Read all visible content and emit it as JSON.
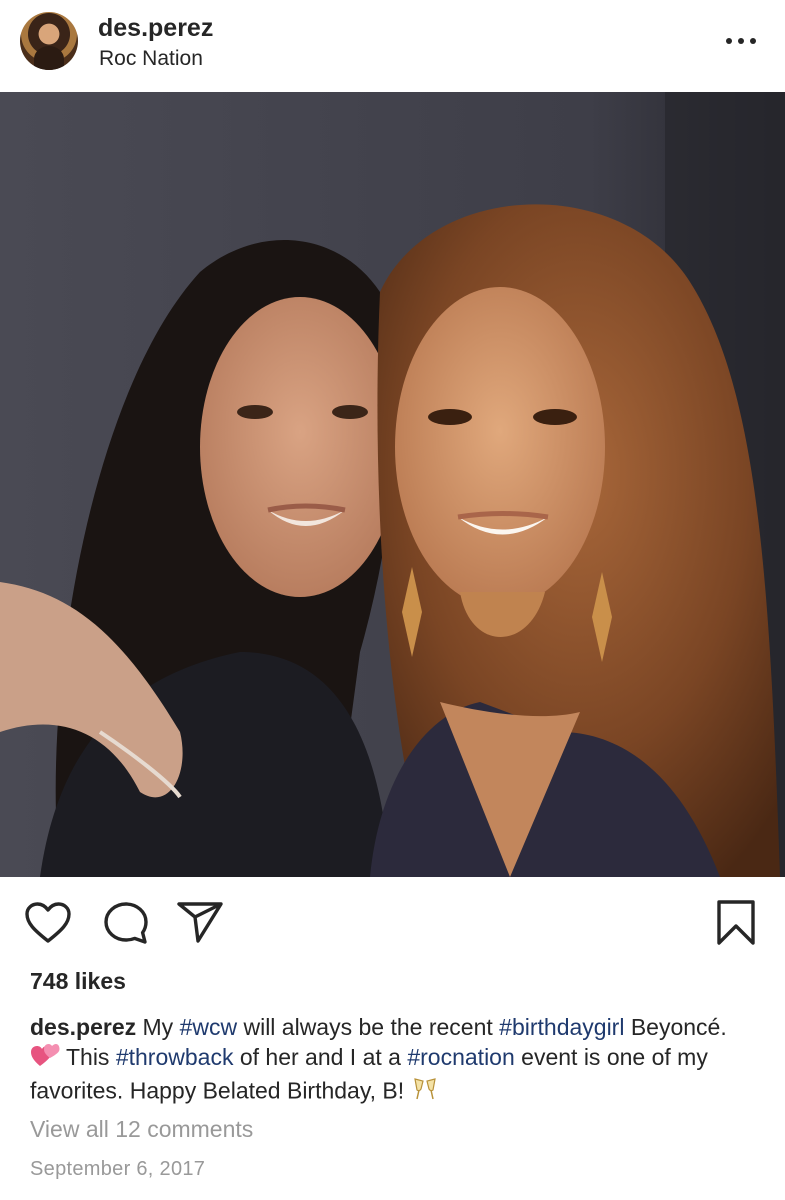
{
  "header": {
    "username": "des.perez",
    "location": "Roc Nation",
    "more_icon": "ellipsis-icon"
  },
  "photo": {
    "subject": "two-women-photo"
  },
  "actions": {
    "like_icon": "heart-icon",
    "comment_icon": "comment-bubble-icon",
    "share_icon": "paper-plane-icon",
    "save_icon": "bookmark-icon"
  },
  "likes": "748 likes",
  "caption": {
    "username": "des.perez",
    "text_1": " My ",
    "tag_wcw": "#wcw",
    "text_2": " will always be the recent ",
    "tag_birthday": "#birthdaygirl",
    "text_3": " Beyoncé. ",
    "emoji_hearts": "💕",
    "text_4": " This ",
    "tag_throwback": "#throwback",
    "text_5": " of her and I at a ",
    "tag_rocnation": "#rocnation",
    "text_6": " event is one of my favorites. Happy Belated Birthday, B! ",
    "emoji_cheers": "🥂"
  },
  "view_comments": "View all 12 comments",
  "date": "September 6, 2017",
  "colors": {
    "text": "#262626",
    "muted": "#999999",
    "hashtag": "#1f3a6e",
    "hearts": "#e75480"
  }
}
